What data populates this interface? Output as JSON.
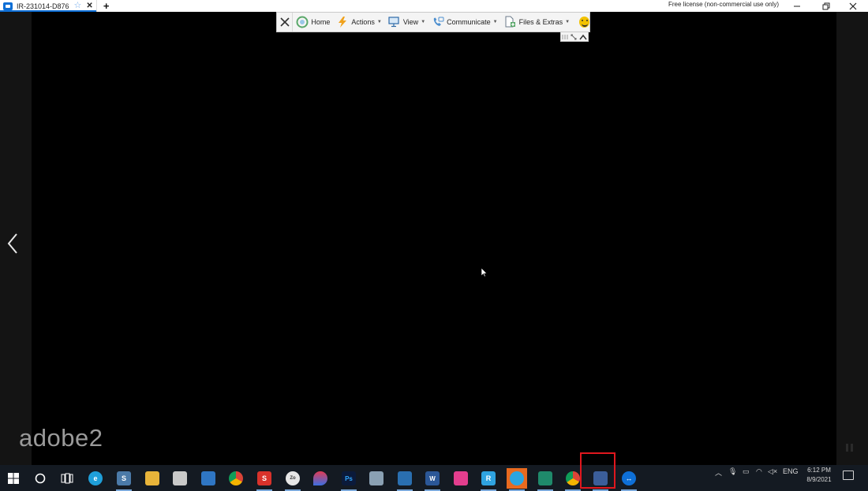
{
  "window": {
    "tab_title": "IR-231014-D876",
    "license_text": "Free license (non-commercial use only)"
  },
  "toolbar": {
    "home": "Home",
    "actions": "Actions",
    "view": "View",
    "communicate": "Communicate",
    "files_extras": "Files & Extras"
  },
  "overlay_label": "adobe2",
  "clock": {
    "time": "6:12 PM",
    "date": "8/9/2021"
  },
  "tray": {
    "language": "ENG"
  },
  "taskbar_apps": [
    "windows-start-icon",
    "cortana-search-icon",
    "task-view-icon",
    "edge-icon",
    "s-app-icon",
    "file-explorer-icon",
    "store-icon",
    "mail-icon",
    "chrome-icon",
    "s-red-app-icon",
    "zoho-app-icon",
    "drop-app-icon",
    "photoshop-icon",
    "notes-app-icon",
    "photo-app-icon",
    "word-icon",
    "pink-app-icon",
    "r-app-icon",
    "telegram-icon",
    "green-app-icon",
    "chrome-profile-icon",
    "remote-support-icon",
    "teamviewer-icon"
  ],
  "colors": {
    "accent": "#0e6fd6",
    "taskbar": "#141a22",
    "highlight": "#e0171e"
  }
}
